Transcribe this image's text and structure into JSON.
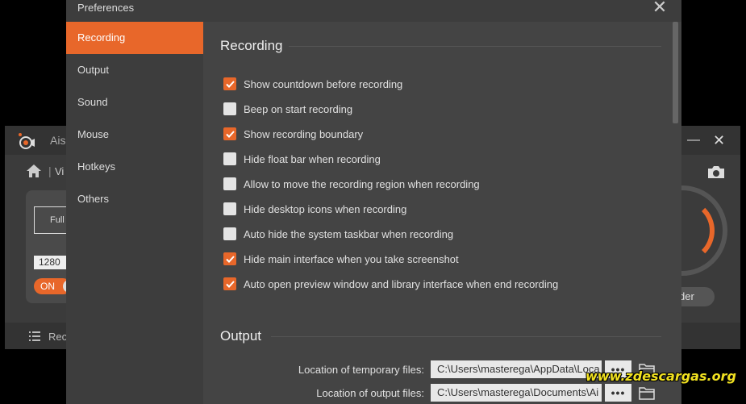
{
  "background_app": {
    "title_fragment": "Ais",
    "mode_fragment": "Vi",
    "region_label": "Full",
    "width_value": "1280",
    "toggle_label": "ON",
    "recorder_fragment": "der",
    "history_fragment": "Rec"
  },
  "dialog": {
    "title": "Preferences",
    "sidebar": [
      {
        "label": "Recording",
        "active": true
      },
      {
        "label": "Output",
        "active": false
      },
      {
        "label": "Sound",
        "active": false
      },
      {
        "label": "Mouse",
        "active": false
      },
      {
        "label": "Hotkeys",
        "active": false
      },
      {
        "label": "Others",
        "active": false
      }
    ],
    "recording": {
      "title": "Recording",
      "options": [
        {
          "label": "Show countdown before recording",
          "checked": true
        },
        {
          "label": "Beep on start recording",
          "checked": false
        },
        {
          "label": "Show recording boundary",
          "checked": true
        },
        {
          "label": "Hide float bar when recording",
          "checked": false
        },
        {
          "label": "Allow to move the recording region when recording",
          "checked": false
        },
        {
          "label": "Hide desktop icons when recording",
          "checked": false
        },
        {
          "label": "Auto hide the system taskbar when recording",
          "checked": false
        },
        {
          "label": "Hide main interface when you take screenshot",
          "checked": true
        },
        {
          "label": "Auto open preview window and library interface when end recording",
          "checked": true
        }
      ]
    },
    "output": {
      "title": "Output",
      "temp_label": "Location of temporary files:",
      "temp_value": "C:\\Users\\masterega\\AppData\\Loca",
      "output_label": "Location of output files:",
      "output_value": "C:\\Users\\masterega\\Documents\\Ai",
      "browse_label": "•••"
    }
  },
  "watermark": "www.zdescargas.org",
  "colors": {
    "accent": "#e8672a",
    "dialog_bg": "#3d3d3d",
    "content_bg": "#444444"
  }
}
